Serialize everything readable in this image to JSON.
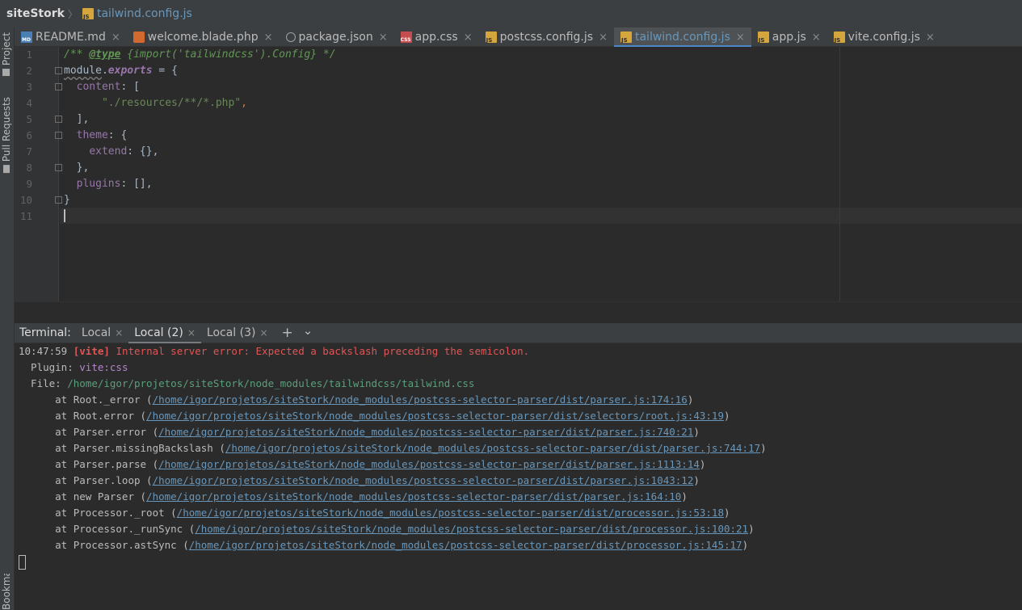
{
  "breadcrumb": {
    "project": "siteStork",
    "file": "tailwind.config.js"
  },
  "leftbar": {
    "project_label": "Project",
    "pull_requests_label": "Pull Requests",
    "bookmarks_label": "Bookmarks"
  },
  "tabs": [
    {
      "label": "README.md",
      "icon": "markdown-file-icon"
    },
    {
      "label": "welcome.blade.php",
      "icon": "php-file-icon"
    },
    {
      "label": "package.json",
      "icon": "json-file-icon"
    },
    {
      "label": "app.css",
      "icon": "css-file-icon"
    },
    {
      "label": "postcss.config.js",
      "icon": "js-file-icon"
    },
    {
      "label": "tailwind.config.js",
      "icon": "js-file-icon",
      "active": true
    },
    {
      "label": "app.js",
      "icon": "js-file-icon"
    },
    {
      "label": "vite.config.js",
      "icon": "js-file-icon"
    }
  ],
  "editor": {
    "line_numbers": [
      "1",
      "2",
      "3",
      "4",
      "5",
      "6",
      "7",
      "8",
      "9",
      "10",
      "11"
    ],
    "code": {
      "l1_open": "/** ",
      "l1_tag": "@type",
      "l1_type": " {import('tailwindcss').Config} */",
      "l2_module": "module",
      "l2_dot": ".",
      "l2_exports": "exports",
      "l2_rest": " = {",
      "l3_key": "content",
      "l3_rest": ": [",
      "l4_str": "\"./resources/**/*.php\"",
      "l4_comma": ",",
      "l5_close": "],",
      "l6_key": "theme",
      "l6_rest": ": {",
      "l7_key": "extend",
      "l7_rest": ": {},",
      "l8_close": "},",
      "l9_key": "plugins",
      "l9_rest": ": [],",
      "l10_close": "}"
    }
  },
  "terminal": {
    "title": "Terminal:",
    "tabs": [
      {
        "label": "Local"
      },
      {
        "label": "Local (2)",
        "active": true
      },
      {
        "label": "Local (3)"
      }
    ],
    "lines": {
      "time": "10:47:59",
      "vite_tag": "[vite]",
      "error_msg": "Internal server error: Expected a backslash preceding the semicolon.",
      "plugin_label": "  Plugin: ",
      "plugin_value": "vite:css",
      "file_label": "  File: ",
      "file_value": "/home/igor/projetos/siteStork/node_modules/tailwindcss/tailwind.css"
    },
    "stack": [
      {
        "at": "      at Root._error (",
        "path": "/home/igor/projetos/siteStork/node_modules/postcss-selector-parser/dist/parser.js:174:16"
      },
      {
        "at": "      at Root.error (",
        "path": "/home/igor/projetos/siteStork/node_modules/postcss-selector-parser/dist/selectors/root.js:43:19"
      },
      {
        "at": "      at Parser.error (",
        "path": "/home/igor/projetos/siteStork/node_modules/postcss-selector-parser/dist/parser.js:740:21"
      },
      {
        "at": "      at Parser.missingBackslash (",
        "path": "/home/igor/projetos/siteStork/node_modules/postcss-selector-parser/dist/parser.js:744:17"
      },
      {
        "at": "      at Parser.parse (",
        "path": "/home/igor/projetos/siteStork/node_modules/postcss-selector-parser/dist/parser.js:1113:14"
      },
      {
        "at": "      at Parser.loop (",
        "path": "/home/igor/projetos/siteStork/node_modules/postcss-selector-parser/dist/parser.js:1043:12"
      },
      {
        "at": "      at new Parser (",
        "path": "/home/igor/projetos/siteStork/node_modules/postcss-selector-parser/dist/parser.js:164:10"
      },
      {
        "at": "      at Processor._root (",
        "path": "/home/igor/projetos/siteStork/node_modules/postcss-selector-parser/dist/processor.js:53:18"
      },
      {
        "at": "      at Processor._runSync (",
        "path": "/home/igor/projetos/siteStork/node_modules/postcss-selector-parser/dist/processor.js:100:21"
      },
      {
        "at": "      at Processor.astSync (",
        "path": "/home/igor/projetos/siteStork/node_modules/postcss-selector-parser/dist/processor.js:145:17"
      }
    ],
    "close_paren": ")",
    "add_button": "+",
    "dropdown_glyph": "⌄",
    "close_glyph": "×"
  },
  "colors": {
    "accent": "#4a88c7",
    "error": "#e05555",
    "link": "#6897bb",
    "string": "#6a8759"
  }
}
